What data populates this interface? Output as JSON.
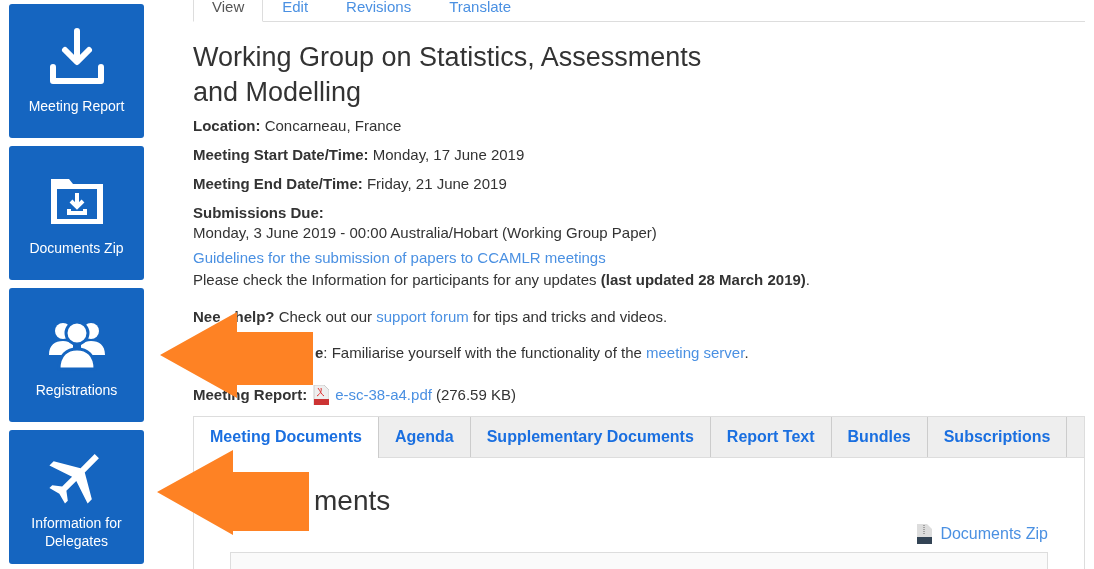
{
  "sidebar": {
    "tiles": [
      {
        "kind": "download",
        "label": "Meeting Report"
      },
      {
        "kind": "folder",
        "label": "Documents Zip"
      },
      {
        "kind": "people",
        "label": "Registrations"
      },
      {
        "kind": "plane",
        "label": "Information for Delegates"
      }
    ]
  },
  "page_tabs": [
    {
      "label": "View",
      "selected": true
    },
    {
      "label": "Edit",
      "selected": false
    },
    {
      "label": "Revisions",
      "selected": false
    },
    {
      "label": "Translate",
      "selected": false
    }
  ],
  "title": "Working Group on Statistics, Assessments and Modelling",
  "fields": [
    {
      "label": "Location:",
      "value": "Concarneau, France"
    },
    {
      "label": "Meeting Start Date/Time:",
      "value": "Monday, 17 June 2019"
    },
    {
      "label": "Meeting End Date/Time:",
      "value": "Friday, 21 June 2019"
    }
  ],
  "submissions": {
    "label": "Submissions Due:",
    "value": "Monday, 3 June 2019 - 00:00 Australia/Hobart (Working Group Paper)"
  },
  "guidelines_link": "Guidelines for the submission of papers to CCAMLR meetings",
  "update_note": "Please check the Information for participants for any updates **(last updated 28 March 2019)**.",
  "help": {
    "label_parts": [
      "Nee",
      "help?"
    ],
    "before": " Check out our ",
    "link": "support forum",
    "after": " for tips and tricks and videos."
  },
  "guide": {
    "label": "e",
    "before": ": Familiarise yourself with the functionality of the ",
    "link": "meeting server",
    "after": "."
  },
  "report": {
    "label": "Meeting Report:",
    "file": "e-sc-38-a4.pdf",
    "size": "(276.59 KB)"
  },
  "doc_tabs": [
    {
      "label": "Meeting Documents",
      "selected": true
    },
    {
      "label": "Agenda",
      "selected": false
    },
    {
      "label": "Supplementary Documents",
      "selected": false
    },
    {
      "label": "Report Text",
      "selected": false
    },
    {
      "label": "Bundles",
      "selected": false
    },
    {
      "label": "Subscriptions",
      "selected": false
    }
  ],
  "documents_heading": "ments",
  "zip_link": "Documents Zip"
}
